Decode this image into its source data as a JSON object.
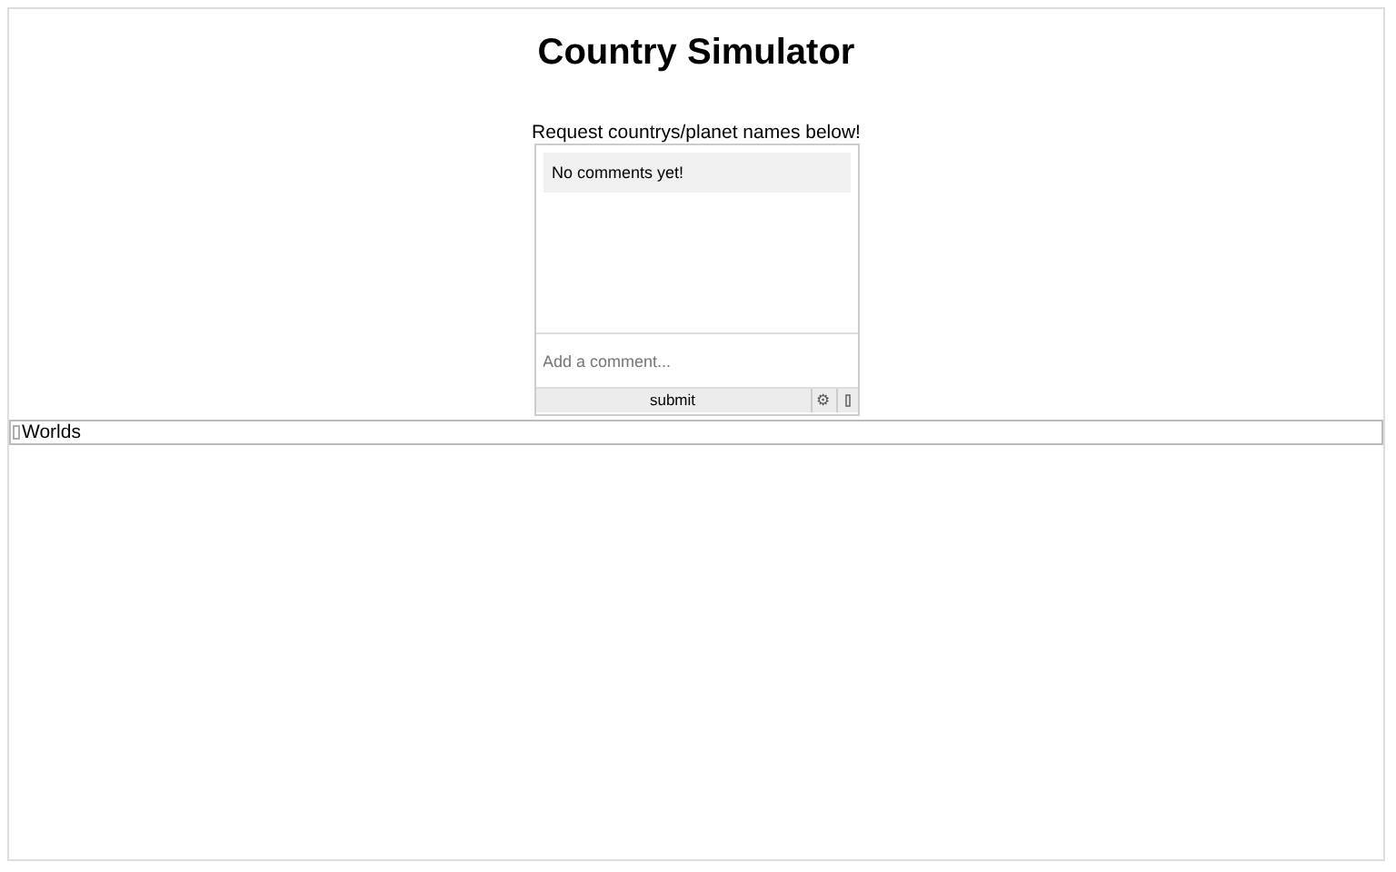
{
  "title": "Country Simulator",
  "comments": {
    "prompt": "Request countrys/planet names below!",
    "empty_message": "No comments yet!",
    "input": {
      "placeholder": "Add a comment..."
    },
    "submit": "submit",
    "settings": "⚙"
  },
  "worlds": {
    "label": "Worlds"
  }
}
